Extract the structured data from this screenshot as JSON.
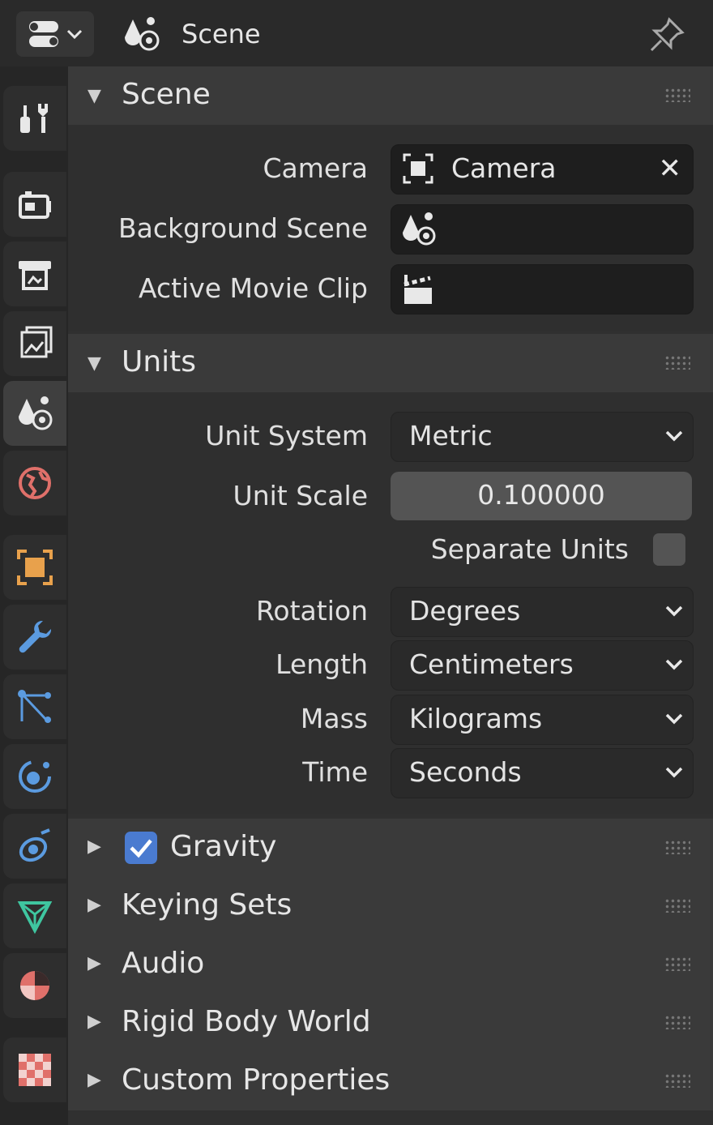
{
  "header": {
    "title": "Scene",
    "editor_icon": "properties-editor-icon",
    "scene_icon": "scene-icon",
    "pin_icon": "pin-icon"
  },
  "sidebar": {
    "tabs": [
      {
        "name": "tool",
        "icon": "tool-icon"
      },
      {
        "name": "render",
        "icon": "render-icon"
      },
      {
        "name": "output",
        "icon": "output-icon"
      },
      {
        "name": "view-layer",
        "icon": "view-layer-icon"
      },
      {
        "name": "scene",
        "icon": "scene-icon",
        "active": true
      },
      {
        "name": "world",
        "icon": "world-icon"
      },
      {
        "name": "object",
        "icon": "object-icon"
      },
      {
        "name": "modifiers",
        "icon": "wrench-icon"
      },
      {
        "name": "particles",
        "icon": "particles-icon"
      },
      {
        "name": "physics",
        "icon": "physics-icon"
      },
      {
        "name": "constraints",
        "icon": "constraints-icon"
      },
      {
        "name": "object-data",
        "icon": "mesh-data-icon"
      },
      {
        "name": "material",
        "icon": "material-icon"
      },
      {
        "name": "texture",
        "icon": "texture-icon"
      }
    ]
  },
  "scene_panel": {
    "title": "Scene",
    "camera_label": "Camera",
    "camera_value": "Camera",
    "background_scene_label": "Background Scene",
    "background_scene_value": "",
    "active_movie_clip_label": "Active Movie Clip",
    "active_movie_clip_value": ""
  },
  "units_panel": {
    "title": "Units",
    "unit_system_label": "Unit System",
    "unit_system_value": "Metric",
    "unit_scale_label": "Unit Scale",
    "unit_scale_value": "0.100000",
    "separate_units_label": "Separate Units",
    "separate_units_checked": false,
    "rotation_label": "Rotation",
    "rotation_value": "Degrees",
    "length_label": "Length",
    "length_value": "Centimeters",
    "mass_label": "Mass",
    "mass_value": "Kilograms",
    "time_label": "Time",
    "time_value": "Seconds"
  },
  "collapsed_panels": {
    "gravity": {
      "label": "Gravity",
      "checked": true
    },
    "keying_sets": "Keying Sets",
    "audio": "Audio",
    "rigid_body_world": "Rigid Body World",
    "custom_properties": "Custom Properties"
  },
  "colors": {
    "accent_checkbox": "#4a7bd0",
    "background": "#303030",
    "panel_header": "#3a3a3a"
  }
}
